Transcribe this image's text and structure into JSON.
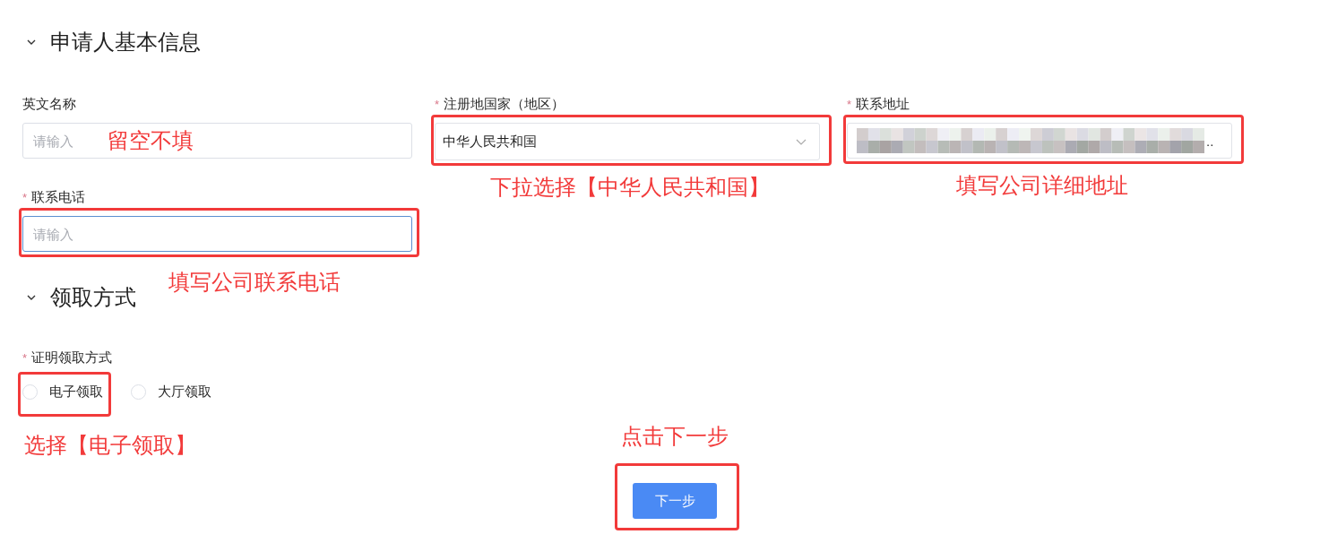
{
  "sections": [
    {
      "title": "申请人基本信息",
      "expanded": true,
      "fields": [
        {
          "kind": "input",
          "label": "英文名称",
          "placeholder": "请输入",
          "focused": false,
          "highlighted": false,
          "annotation": "留空不填"
        },
        {
          "kind": "select",
          "required_mark": "*",
          "label": "注册地国家（地区）",
          "value": "中华人民共和国",
          "highlighted": true,
          "annotation": "下拉选择【中华人民共和国】"
        },
        {
          "kind": "blurred",
          "required_mark": "*",
          "label": "联系地址",
          "value": "..",
          "highlighted": true,
          "annotation": "填写公司详细地址"
        },
        {
          "kind": "input",
          "required_mark": "*",
          "label": "联系电话",
          "placeholder": "请输入",
          "focused": true,
          "highlighted": true,
          "annotation": "填写公司联系电话"
        }
      ]
    },
    {
      "title": "领取方式",
      "expanded": true,
      "fields": [
        {
          "kind": "radio",
          "required_mark": "*",
          "label": "证明领取方式",
          "options": [
            {
              "label": "电子领取",
              "selected": false,
              "highlighted": true,
              "annotation": "选择【电子领取】"
            },
            {
              "label": "大厅领取",
              "selected": false,
              "highlighted": false
            }
          ]
        }
      ]
    }
  ],
  "next_button": {
    "label": "下一步",
    "highlighted": true,
    "annotation": "点击下一步"
  }
}
